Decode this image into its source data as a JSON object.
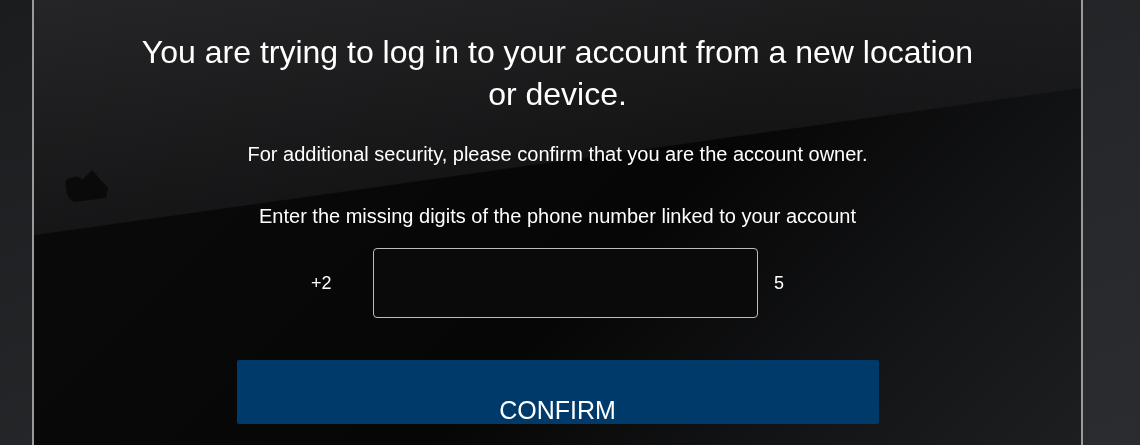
{
  "heading": "You are trying to log in to your account from a new location or device.",
  "subtitle": "For additional security, please confirm that you are the account owner.",
  "instruction": "Enter the missing digits of the phone number linked to your account",
  "phone": {
    "prefix": "+2",
    "suffix": "5"
  },
  "button": "CONFIRM"
}
